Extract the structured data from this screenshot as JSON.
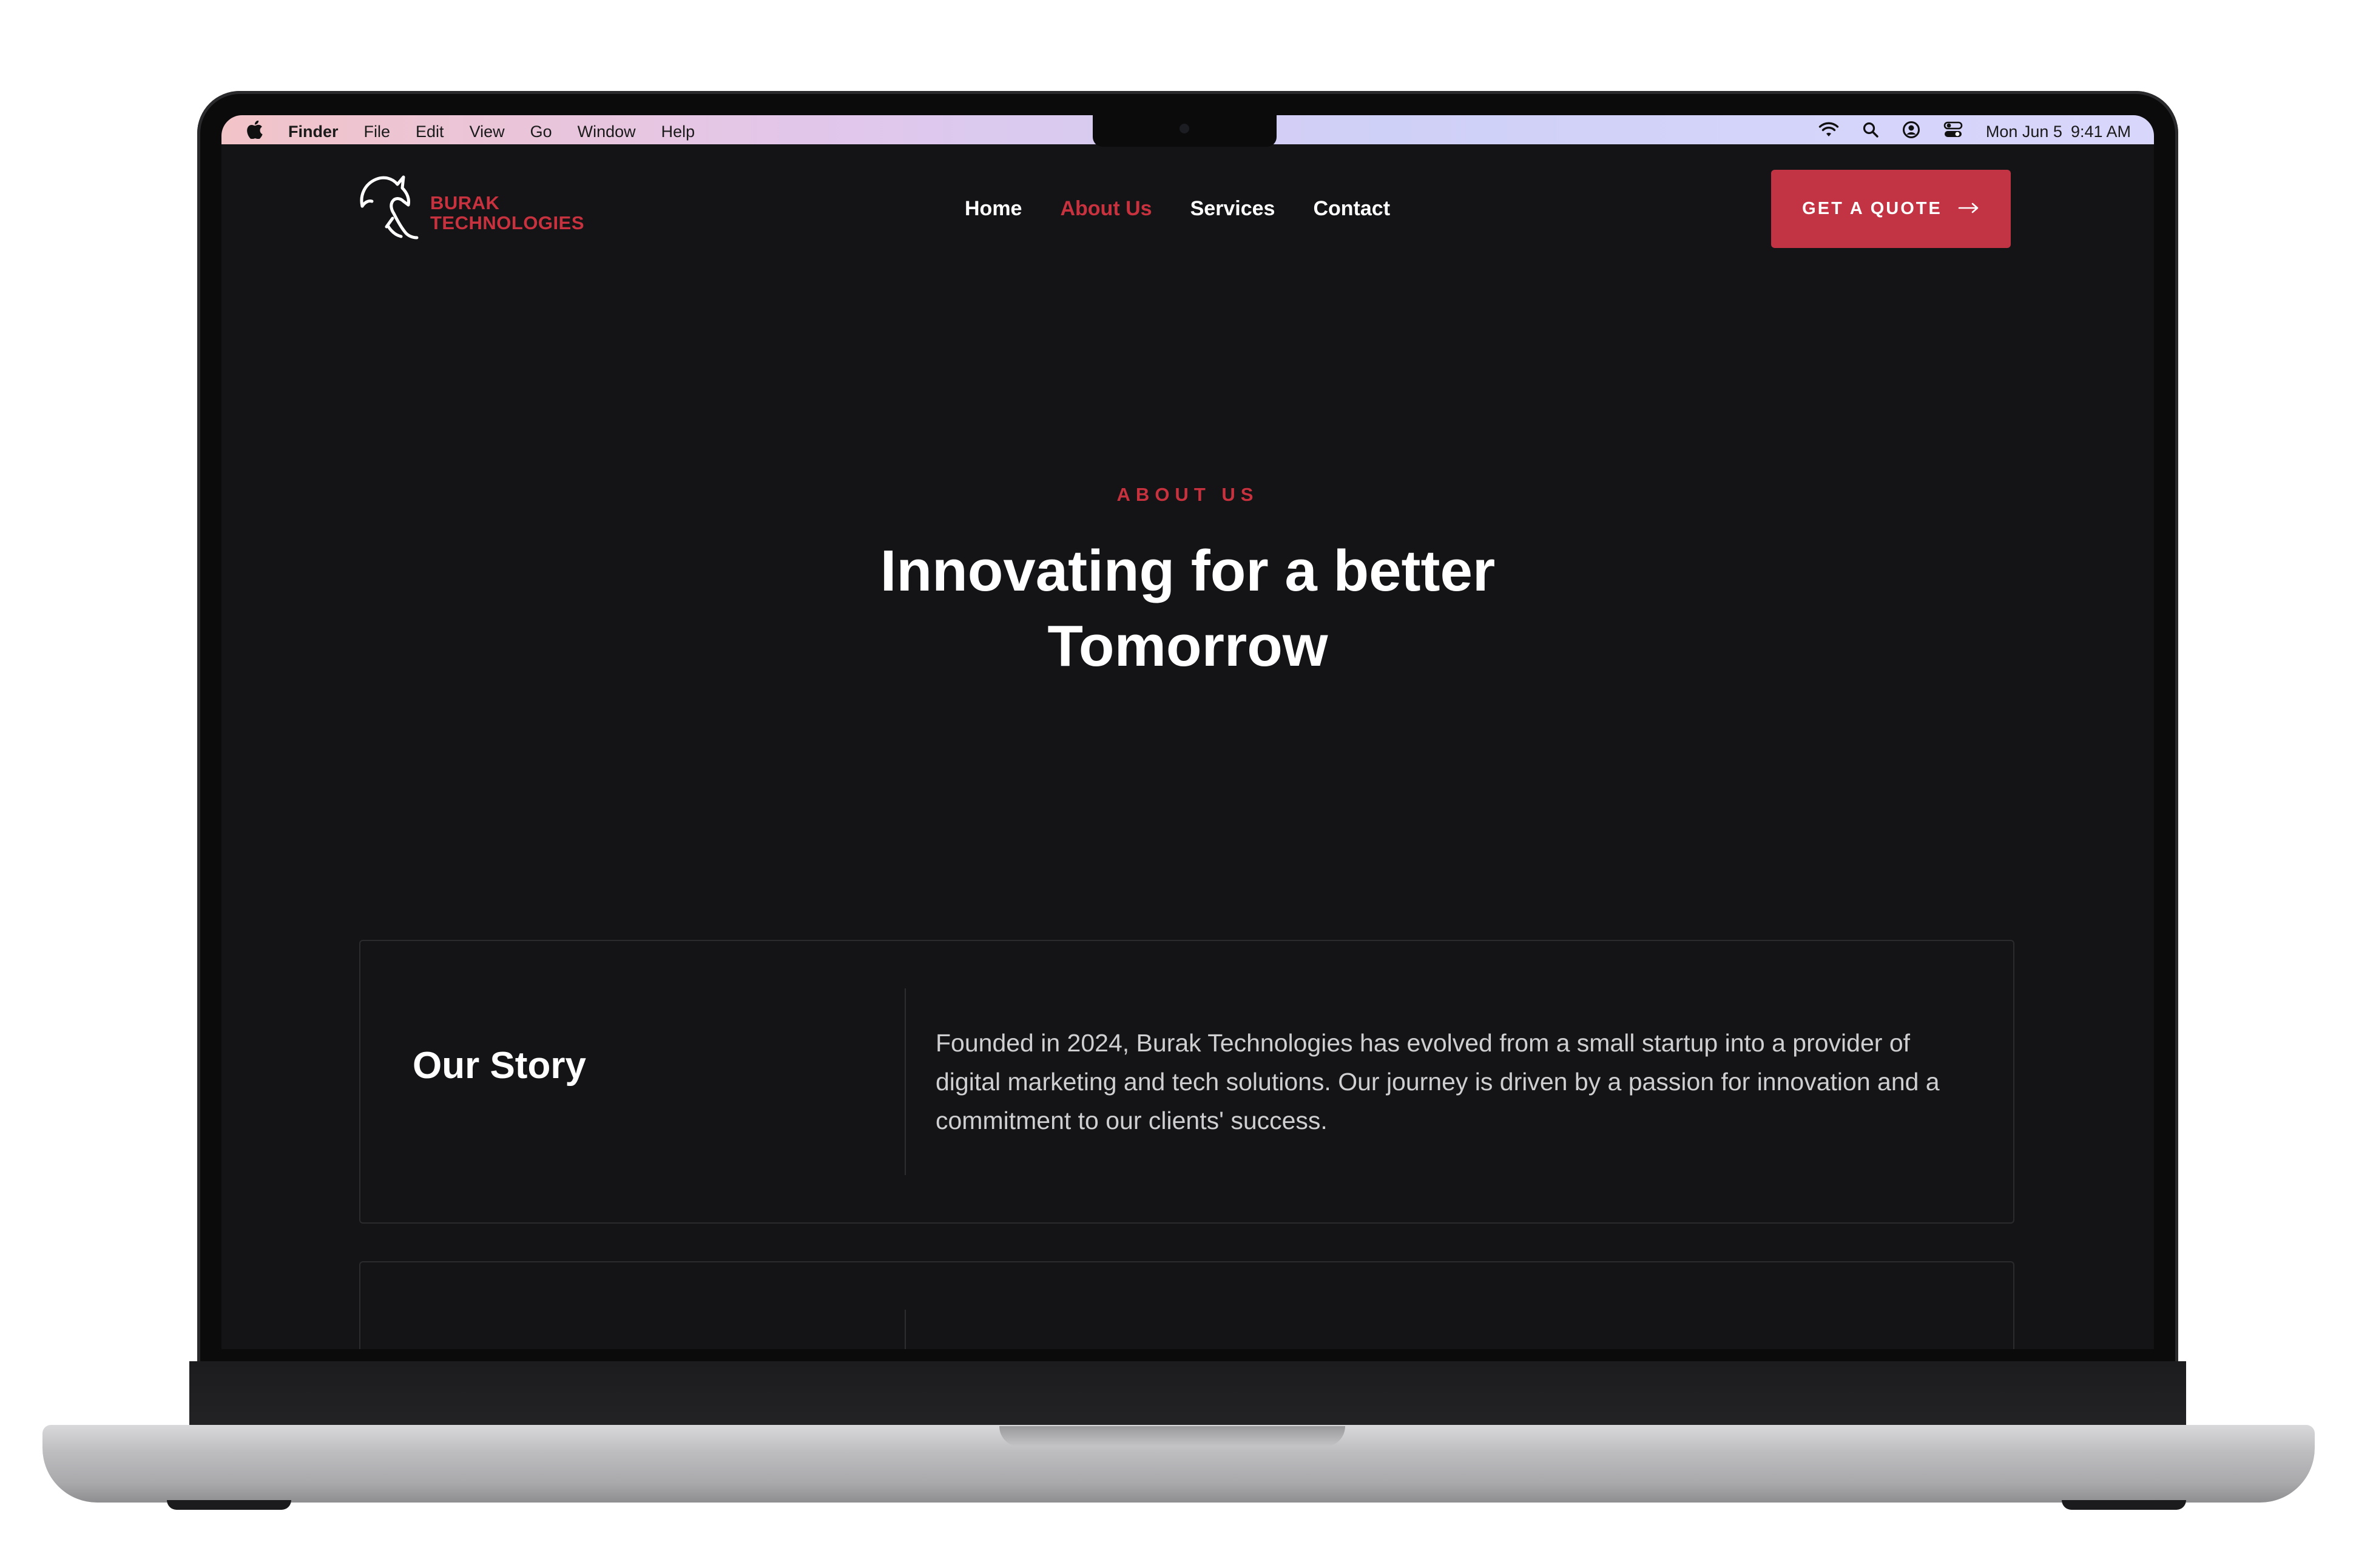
{
  "menubar": {
    "apple": "",
    "items": [
      "Finder",
      "File",
      "Edit",
      "View",
      "Go",
      "Window",
      "Help"
    ],
    "date": "Mon Jun 5",
    "time": "9:41 AM"
  },
  "site": {
    "logo": {
      "line1": "BURAK",
      "line2": "TECHNOLOGIES"
    },
    "nav": [
      "Home",
      "About Us",
      "Services",
      "Contact"
    ],
    "active_nav": "About Us",
    "cta_label": "GET A QUOTE",
    "cta_icon": "arrow-right-icon",
    "brand_color": "#c8323e"
  },
  "hero": {
    "eyebrow": "ABOUT US",
    "headline_line1": "Innovating for a better",
    "headline_line2": "Tomorrow"
  },
  "story": {
    "title": "Our Story",
    "body": "Founded in 2024, Burak Technologies has evolved from a small startup into a provider of digital marketing and tech solutions. Our journey is driven by a passion for innovation and a commitment to our clients' success."
  }
}
